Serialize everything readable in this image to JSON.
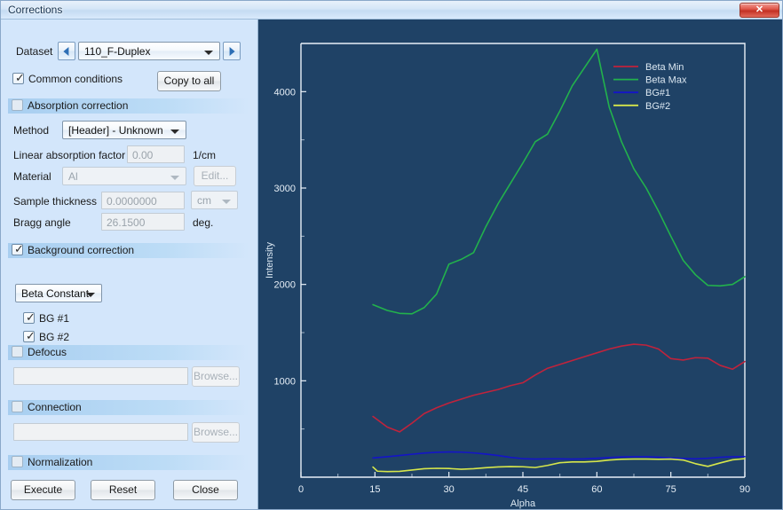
{
  "window": {
    "title": "Corrections",
    "close_label": "✕"
  },
  "form": {
    "dataset_label": "Dataset",
    "dataset_value": "110_F-Duplex",
    "prev_icon": "triangle-left-icon",
    "next_icon": "triangle-right-icon",
    "common_conditions_label": "Common conditions",
    "common_conditions_checked": true,
    "copy_to_all_label": "Copy to all",
    "absorption": {
      "section_label": "Absorption correction",
      "checked": false,
      "method_label": "Method",
      "method_value": "[Header] - Unknown",
      "linear_factor_label": "Linear absorption factor",
      "linear_factor_value": "0.00",
      "linear_factor_unit": "1/cm",
      "material_label": "Material",
      "material_value": "Al",
      "edit_label": "Edit...",
      "thickness_label": "Sample thickness",
      "thickness_value": "0.0000000",
      "thickness_unit": "cm",
      "bragg_label": "Bragg angle",
      "bragg_value": "26.1500",
      "bragg_unit": "deg."
    },
    "background": {
      "section_label": "Background correction",
      "checked": true,
      "mode_value": "Beta Constant",
      "bg1_label": "BG #1",
      "bg1_checked": true,
      "bg2_label": "BG #2",
      "bg2_checked": true
    },
    "defocus": {
      "section_label": "Defocus",
      "checked": false,
      "path_value": "",
      "browse_label": "Browse..."
    },
    "connection": {
      "section_label": "Connection",
      "checked": false,
      "path_value": "",
      "browse_label": "Browse..."
    },
    "normalization": {
      "section_label": "Normalization",
      "checked": false
    },
    "actions": {
      "execute_label": "Execute",
      "reset_label": "Reset",
      "close_label": "Close"
    }
  },
  "chart_data": {
    "type": "line",
    "title": "",
    "xlabel": "Alpha",
    "ylabel": "Intensity",
    "xlim": [
      0,
      90
    ],
    "ylim": [
      0,
      4500
    ],
    "xticks": [
      0,
      15,
      30,
      45,
      60,
      75,
      90
    ],
    "yticks": [
      1000,
      2000,
      3000,
      4000
    ],
    "minor_xticks": [
      7.5,
      22.5,
      37.5,
      52.5,
      67.5,
      82.5
    ],
    "minor_yticks": [
      500,
      1500,
      2500,
      3500
    ],
    "grid": false,
    "background": "#1f4266",
    "legend_position": "top-right",
    "series": [
      {
        "name": "Beta Min",
        "color": "#c0233c",
        "x": [
          14.6,
          17.5,
          20,
          22.5,
          25,
          27.5,
          30,
          32.5,
          35,
          37.5,
          40,
          42.5,
          45,
          47.5,
          50,
          52.5,
          55,
          57.5,
          60,
          62.5,
          65,
          67.5,
          70,
          72.5,
          75,
          77.5,
          80,
          82.5,
          85,
          87.5,
          90
        ],
        "y": [
          630,
          520,
          470,
          560,
          660,
          720,
          770,
          810,
          850,
          880,
          910,
          950,
          980,
          1060,
          1130,
          1170,
          1210,
          1250,
          1290,
          1330,
          1360,
          1380,
          1370,
          1330,
          1230,
          1215,
          1240,
          1235,
          1160,
          1120,
          1200
        ]
      },
      {
        "name": "Beta Max",
        "color": "#22b24c",
        "x": [
          14.6,
          17.5,
          20,
          22.5,
          25,
          27.5,
          30,
          32.5,
          35,
          37.5,
          40,
          42.5,
          45,
          47.5,
          50,
          52.5,
          55,
          57.5,
          60,
          62.5,
          65,
          67.5,
          70,
          72.5,
          75,
          77.5,
          80,
          82.5,
          85,
          87.5,
          90
        ],
        "y": [
          1790,
          1730,
          1700,
          1695,
          1760,
          1900,
          2210,
          2260,
          2330,
          2600,
          2840,
          3050,
          3260,
          3480,
          3560,
          3800,
          4060,
          4250,
          4440,
          3840,
          3480,
          3200,
          3000,
          2760,
          2500,
          2250,
          2100,
          1990,
          1985,
          2000,
          2080
        ]
      },
      {
        "name": "BG#1",
        "color": "#1414c8",
        "x": [
          14.6,
          17.5,
          20,
          22.5,
          25,
          27.5,
          30,
          32.5,
          35,
          37.5,
          40,
          42.5,
          45,
          47.5,
          50,
          52.5,
          55,
          57.5,
          60,
          62.5,
          65,
          67.5,
          70,
          72.5,
          75,
          77.5,
          80,
          82.5,
          85,
          87.5,
          90
        ],
        "y": [
          200,
          212,
          225,
          238,
          250,
          258,
          262,
          260,
          252,
          240,
          225,
          205,
          192,
          188,
          190,
          190,
          188,
          190,
          196,
          204,
          210,
          212,
          212,
          208,
          200,
          194,
          190,
          196,
          206,
          212,
          214
        ]
      },
      {
        "name": "BG#2",
        "color": "#d6e64b",
        "x": [
          14.6,
          15.5,
          17.5,
          20,
          22.5,
          25,
          27.5,
          30,
          32.5,
          35,
          37.5,
          40,
          42.5,
          45,
          47.5,
          50,
          52.5,
          55,
          57.5,
          60,
          62.5,
          65,
          67.5,
          70,
          72.5,
          75,
          77.5,
          80,
          82.5,
          85,
          87.5,
          90
        ],
        "y": [
          105,
          62,
          58,
          60,
          74,
          88,
          92,
          90,
          82,
          88,
          98,
          106,
          110,
          108,
          100,
          122,
          150,
          158,
          158,
          164,
          178,
          186,
          188,
          188,
          186,
          188,
          178,
          140,
          112,
          148,
          180,
          192
        ]
      }
    ]
  }
}
